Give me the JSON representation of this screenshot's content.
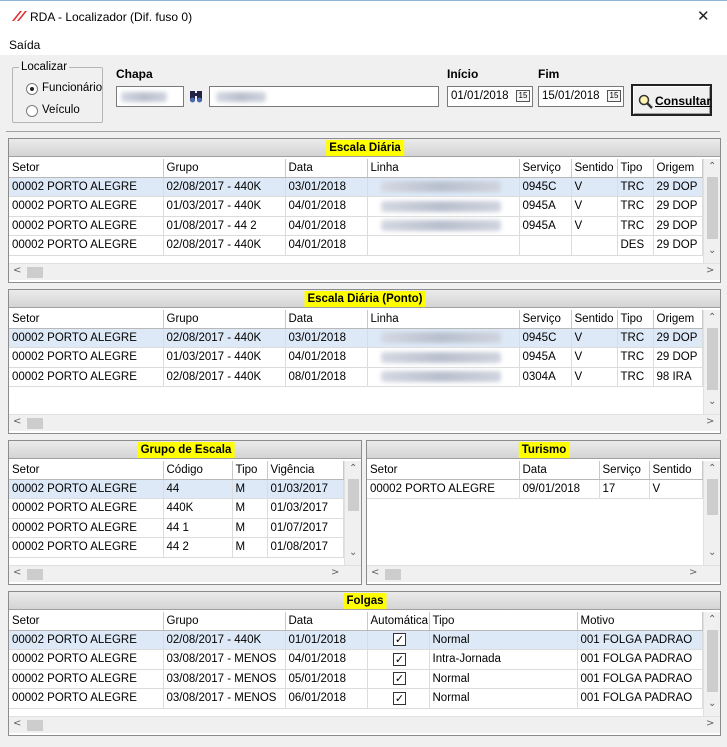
{
  "window": {
    "title": "RDA - Localizador (Dif. fuso 0)",
    "close": "✕"
  },
  "menu": {
    "saida": "Saída"
  },
  "filters": {
    "localizar": "Localizar",
    "funcionario": "Funcionário",
    "veiculo": "Veículo",
    "chapa": "Chapa",
    "inicio": "Início",
    "fim": "Fim",
    "inicio_value": "01/01/2018",
    "fim_value": "15/01/2018",
    "consultar": "Consultar"
  },
  "escala": {
    "title": "Escala Diária",
    "headers": [
      "Setor",
      "Grupo",
      "Data",
      "Linha",
      "Serviço",
      "Sentido",
      "Tipo",
      "Origem"
    ],
    "rows": [
      [
        "00002 PORTO ALEGRE",
        "02/08/2017 - 440K",
        "03/01/2018",
        "",
        "0945C",
        "V",
        "TRC",
        "29 DOP"
      ],
      [
        "00002 PORTO ALEGRE",
        "01/03/2017 - 440K",
        "04/01/2018",
        "",
        "0945A",
        "V",
        "TRC",
        "29 DOP"
      ],
      [
        "00002 PORTO ALEGRE",
        "01/08/2017 - 44 2",
        "04/01/2018",
        "",
        "0945A",
        "V",
        "TRC",
        "29 DOP"
      ],
      [
        "00002 PORTO ALEGRE",
        "02/08/2017 - 440K",
        "04/01/2018",
        "",
        "",
        "",
        "DES",
        "29 DOP"
      ]
    ]
  },
  "ponto": {
    "title": "Escala Diária (Ponto)",
    "headers": [
      "Setor",
      "Grupo",
      "Data",
      "Linha",
      "Serviço",
      "Sentido",
      "Tipo",
      "Origem"
    ],
    "rows": [
      [
        "00002 PORTO ALEGRE",
        "02/08/2017 - 440K",
        "03/01/2018",
        "",
        "0945C",
        "V",
        "TRC",
        "29 DOP"
      ],
      [
        "00002 PORTO ALEGRE",
        "01/03/2017 - 440K",
        "04/01/2018",
        "",
        "0945A",
        "V",
        "TRC",
        "29 DOP"
      ],
      [
        "00002 PORTO ALEGRE",
        "02/08/2017 - 440K",
        "08/01/2018",
        "",
        "0304A",
        "V",
        "TRC",
        "98 IRA"
      ]
    ]
  },
  "grupo": {
    "title": "Grupo de Escala",
    "headers": [
      "Setor",
      "Código",
      "Tipo",
      "Vigência"
    ],
    "rows": [
      [
        "00002 PORTO ALEGRE",
        "44",
        "M",
        "01/03/2017"
      ],
      [
        "00002 PORTO ALEGRE",
        "440K",
        "M",
        "01/03/2017"
      ],
      [
        "00002 PORTO ALEGRE",
        "44 1",
        "M",
        "01/07/2017"
      ],
      [
        "00002 PORTO ALEGRE",
        "44 2",
        "M",
        "01/08/2017"
      ]
    ]
  },
  "turismo": {
    "title": "Turismo",
    "headers": [
      "Setor",
      "Data",
      "Serviço",
      "Sentido"
    ],
    "rows": [
      [
        "00002 PORTO ALEGRE",
        "09/01/2018",
        "17",
        "V"
      ]
    ]
  },
  "folgas": {
    "title": "Folgas",
    "headers": [
      "Setor",
      "Grupo",
      "Data",
      "Automática",
      "Tipo",
      "Motivo"
    ],
    "check": "✓",
    "rows": [
      [
        "00002 PORTO ALEGRE",
        "02/08/2017 - 440K",
        "01/01/2018",
        "",
        "Normal",
        "001 FOLGA PADRAO"
      ],
      [
        "00002 PORTO ALEGRE",
        "03/08/2017 - MENOS",
        "04/01/2018",
        "",
        "Intra-Jornada",
        "001 FOLGA PADRAO"
      ],
      [
        "00002 PORTO ALEGRE",
        "03/08/2017 - MENOS",
        "05/01/2018",
        "",
        "Normal",
        "001 FOLGA PADRAO"
      ],
      [
        "00002 PORTO ALEGRE",
        "03/08/2017 - MENOS",
        "06/01/2018",
        "",
        "Normal",
        "001 FOLGA PADRAO"
      ]
    ]
  },
  "colors": {
    "highlight": "#ffff00",
    "selected_row": "#dde9f7",
    "accent": "#e03030"
  },
  "icons": {
    "logo": "rda-logo-icon",
    "binoculars": "binoculars-icon",
    "calendar": "calendar-icon",
    "search": "magnifier-icon"
  }
}
